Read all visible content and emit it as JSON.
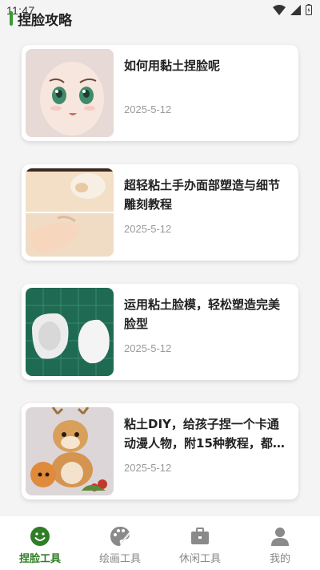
{
  "status_bar": {
    "time": "11:47"
  },
  "header": {
    "title": "捏脸攻略"
  },
  "articles": [
    {
      "title": "如何用黏土捏脸呢",
      "date": "2025-5-12",
      "thumb_icon": "clay-doll-face-image"
    },
    {
      "title": "超轻粘土手办面部塑造与细节雕刻教程",
      "date": "2025-5-12",
      "thumb_icon": "clay-face-sculpting-image"
    },
    {
      "title": "运用粘土脸模，轻松塑造完美脸型",
      "date": "2025-5-12",
      "thumb_icon": "clay-face-mold-image"
    },
    {
      "title": "粘土DIY，给孩子捏一个卡通动漫人物，附15种教程，都很…",
      "date": "2025-5-12",
      "thumb_icon": "clay-deer-figure-image"
    }
  ],
  "tabs": [
    {
      "label": "捏脸工具",
      "icon": "smiley-face-icon",
      "active": true
    },
    {
      "label": "绘画工具",
      "icon": "palette-icon",
      "active": false
    },
    {
      "label": "休闲工具",
      "icon": "briefcase-icon",
      "active": false
    },
    {
      "label": "我的",
      "icon": "person-icon",
      "active": false
    }
  ],
  "colors": {
    "accent": "#2f7d26",
    "inactive": "#888888",
    "background": "#f4f4f4"
  }
}
